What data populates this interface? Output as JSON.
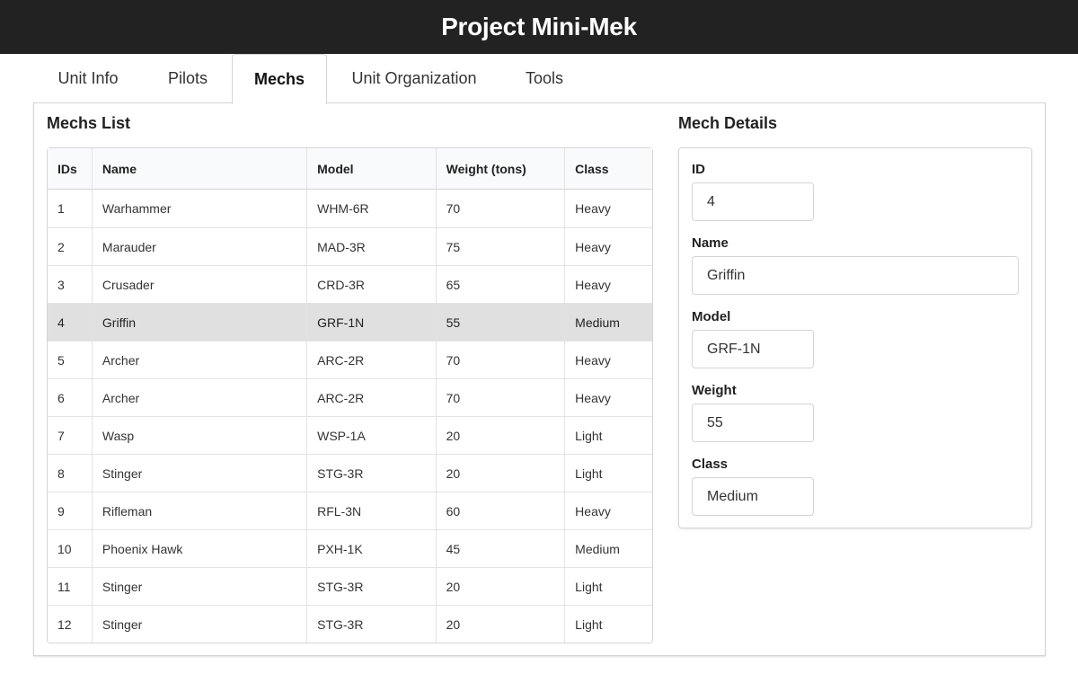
{
  "app": {
    "title": "Project Mini-Mek"
  },
  "tabs": [
    {
      "label": "Unit Info"
    },
    {
      "label": "Pilots"
    },
    {
      "label": "Mechs"
    },
    {
      "label": "Unit Organization"
    },
    {
      "label": "Tools"
    }
  ],
  "active_tab": "Mechs",
  "mechs_list": {
    "title": "Mechs List",
    "columns": [
      "IDs",
      "Name",
      "Model",
      "Weight (tons)",
      "Class"
    ],
    "rows": [
      [
        "1",
        "Warhammer",
        "WHM-6R",
        "70",
        "Heavy"
      ],
      [
        "2",
        "Marauder",
        "MAD-3R",
        "75",
        "Heavy"
      ],
      [
        "3",
        "Crusader",
        "CRD-3R",
        "65",
        "Heavy"
      ],
      [
        "4",
        "Griffin",
        "GRF-1N",
        "55",
        "Medium"
      ],
      [
        "5",
        "Archer",
        "ARC-2R",
        "70",
        "Heavy"
      ],
      [
        "6",
        "Archer",
        "ARC-2R",
        "70",
        "Heavy"
      ],
      [
        "7",
        "Wasp",
        "WSP-1A",
        "20",
        "Light"
      ],
      [
        "8",
        "Stinger",
        "STG-3R",
        "20",
        "Light"
      ],
      [
        "9",
        "Rifleman",
        "RFL-3N",
        "60",
        "Heavy"
      ],
      [
        "10",
        "Phoenix Hawk",
        "PXH-1K",
        "45",
        "Medium"
      ],
      [
        "11",
        "Stinger",
        "STG-3R",
        "20",
        "Light"
      ],
      [
        "12",
        "Stinger",
        "STG-3R",
        "20",
        "Light"
      ]
    ],
    "selected_id": "4"
  },
  "mech_details": {
    "title": "Mech Details",
    "fields": {
      "id": {
        "label": "ID",
        "value": "4"
      },
      "name": {
        "label": "Name",
        "value": "Griffin"
      },
      "model": {
        "label": "Model",
        "value": "GRF-1N"
      },
      "weight": {
        "label": "Weight",
        "value": "55"
      },
      "class": {
        "label": "Class",
        "value": "Medium"
      }
    }
  },
  "colors": {
    "header_bg": "#222222",
    "selected_row_bg": "#e0e0e0",
    "border": "#d4d4d5"
  }
}
